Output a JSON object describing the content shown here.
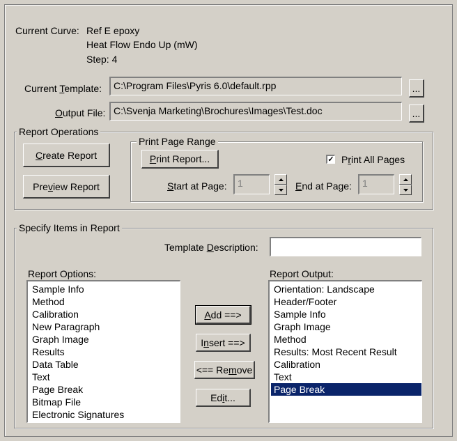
{
  "current_curve": {
    "label": "Current Curve:",
    "line1": "Ref E epoxy",
    "line2": "Heat Flow Endo Up (mW)",
    "line3": "Step: 4"
  },
  "template": {
    "label": "Current Template:",
    "value": "C:\\Program Files\\Pyris 6.0\\default.rpp",
    "browse": "..."
  },
  "output": {
    "label": "Output File:",
    "value": "C:\\Svenja Marketing\\Brochures\\Images\\Test.doc",
    "browse": "..."
  },
  "report_ops": {
    "legend": "Report Operations",
    "create": "Create Report",
    "preview": "Preview Report"
  },
  "print_range": {
    "legend": "Print Page Range",
    "print_button": "Print Report...",
    "print_all_label": "Print All Pages",
    "print_all_checked": "✓",
    "start_label": "Start at Page:",
    "start_value": "1",
    "end_label": "End at Page:",
    "end_value": "1"
  },
  "items": {
    "legend": "Specify Items in Report",
    "template_desc_label": "Template Description:",
    "template_desc_value": "",
    "options_label": "Report Options:",
    "output_label": "Report Output:",
    "options": [
      "Sample Info",
      "Method",
      "Calibration",
      "New Paragraph",
      "Graph Image",
      "Results",
      "Data Table",
      "Text",
      "Page Break",
      "Bitmap File",
      "Electronic Signatures"
    ],
    "outputs": [
      "Orientation: Landscape",
      "Header/Footer",
      "Sample Info",
      "Graph Image",
      "Method",
      "Results: Most Recent Result",
      "Calibration",
      "Text",
      "Page Break"
    ],
    "selected_output": "Page Break",
    "add": "Add ==>",
    "insert": "Insert ==>",
    "remove": "<== Remove",
    "edit": "Edit..."
  }
}
